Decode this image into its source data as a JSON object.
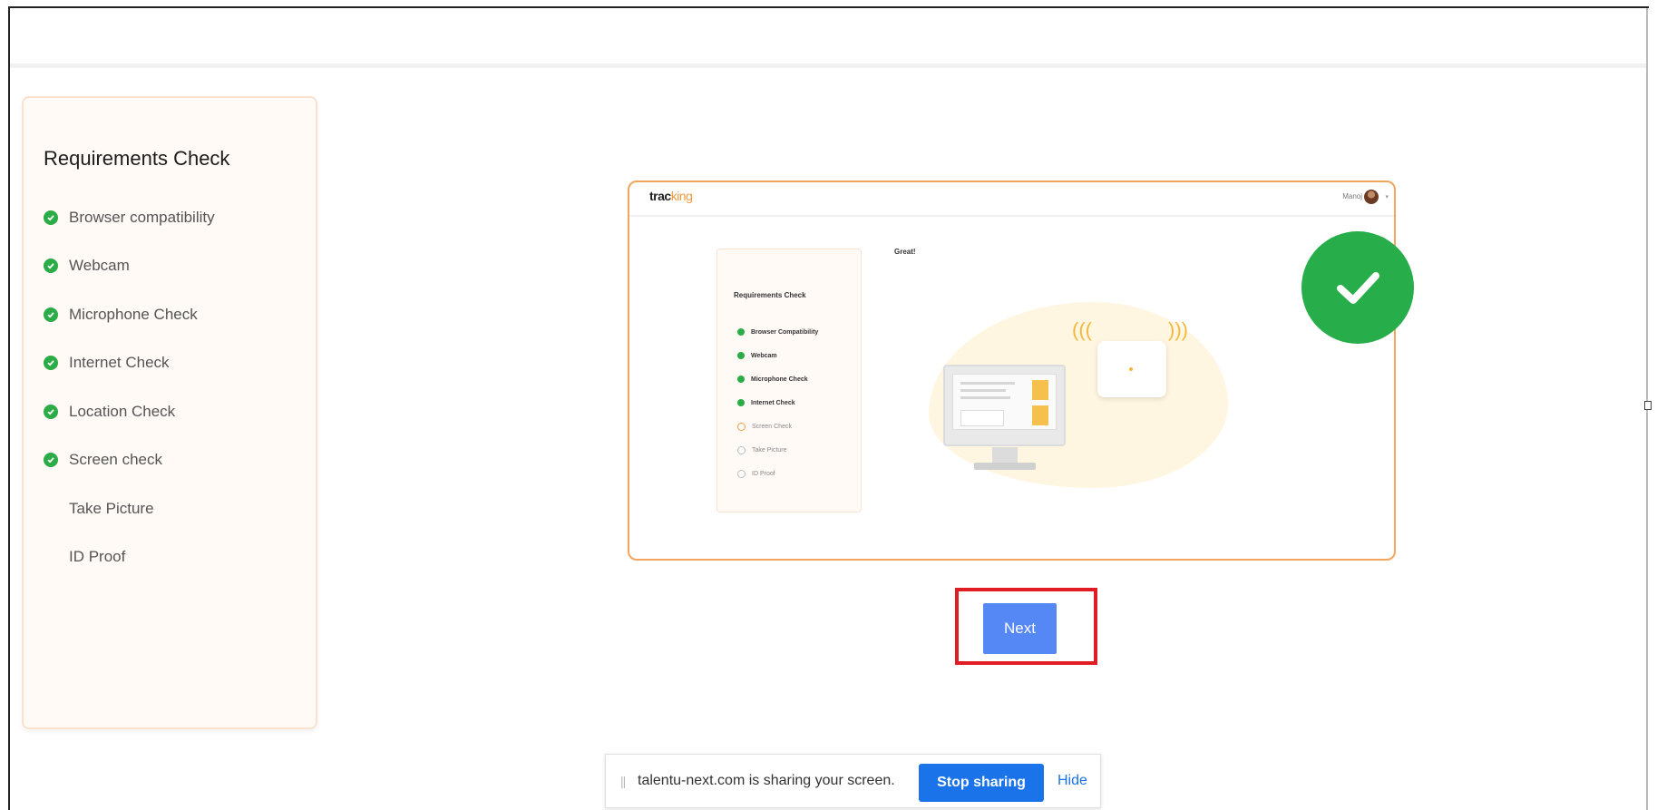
{
  "sidebar": {
    "title": "Requirements Check",
    "items": [
      {
        "label": "Browser compatibility",
        "done": true
      },
      {
        "label": "Webcam",
        "done": true
      },
      {
        "label": "Microphone Check",
        "done": true
      },
      {
        "label": "Internet Check",
        "done": true
      },
      {
        "label": "Location Check",
        "done": true
      },
      {
        "label": "Screen check",
        "done": true
      },
      {
        "label": "Take Picture",
        "done": false
      },
      {
        "label": "ID Proof",
        "done": false
      }
    ]
  },
  "preview": {
    "logo_dark": "trac",
    "logo_accent": "king",
    "user_name": "Manoj",
    "side_title": "Requirements Check",
    "items": [
      {
        "label": "Browser Compatibility",
        "state": "done"
      },
      {
        "label": "Webcam",
        "state": "done"
      },
      {
        "label": "Microphone Check",
        "state": "done"
      },
      {
        "label": "Internet Check",
        "state": "done"
      },
      {
        "label": "Screen Check",
        "state": "current"
      },
      {
        "label": "Take Picture",
        "state": "pending"
      },
      {
        "label": "ID Proof",
        "state": "pending"
      }
    ],
    "great_text": "Great!"
  },
  "actions": {
    "next_label": "Next"
  },
  "share_bar": {
    "message": "talentu-next.com is sharing your screen.",
    "stop_label": "Stop sharing",
    "hide_label": "Hide"
  },
  "colors": {
    "success_green": "#2bac46",
    "accent_orange": "#f3a55e",
    "next_blue": "#5587f5",
    "highlight_red": "#e01c25",
    "chrome_blue": "#1a73e8"
  },
  "icons": {
    "check": "check-icon",
    "big_check": "success-check-icon"
  }
}
